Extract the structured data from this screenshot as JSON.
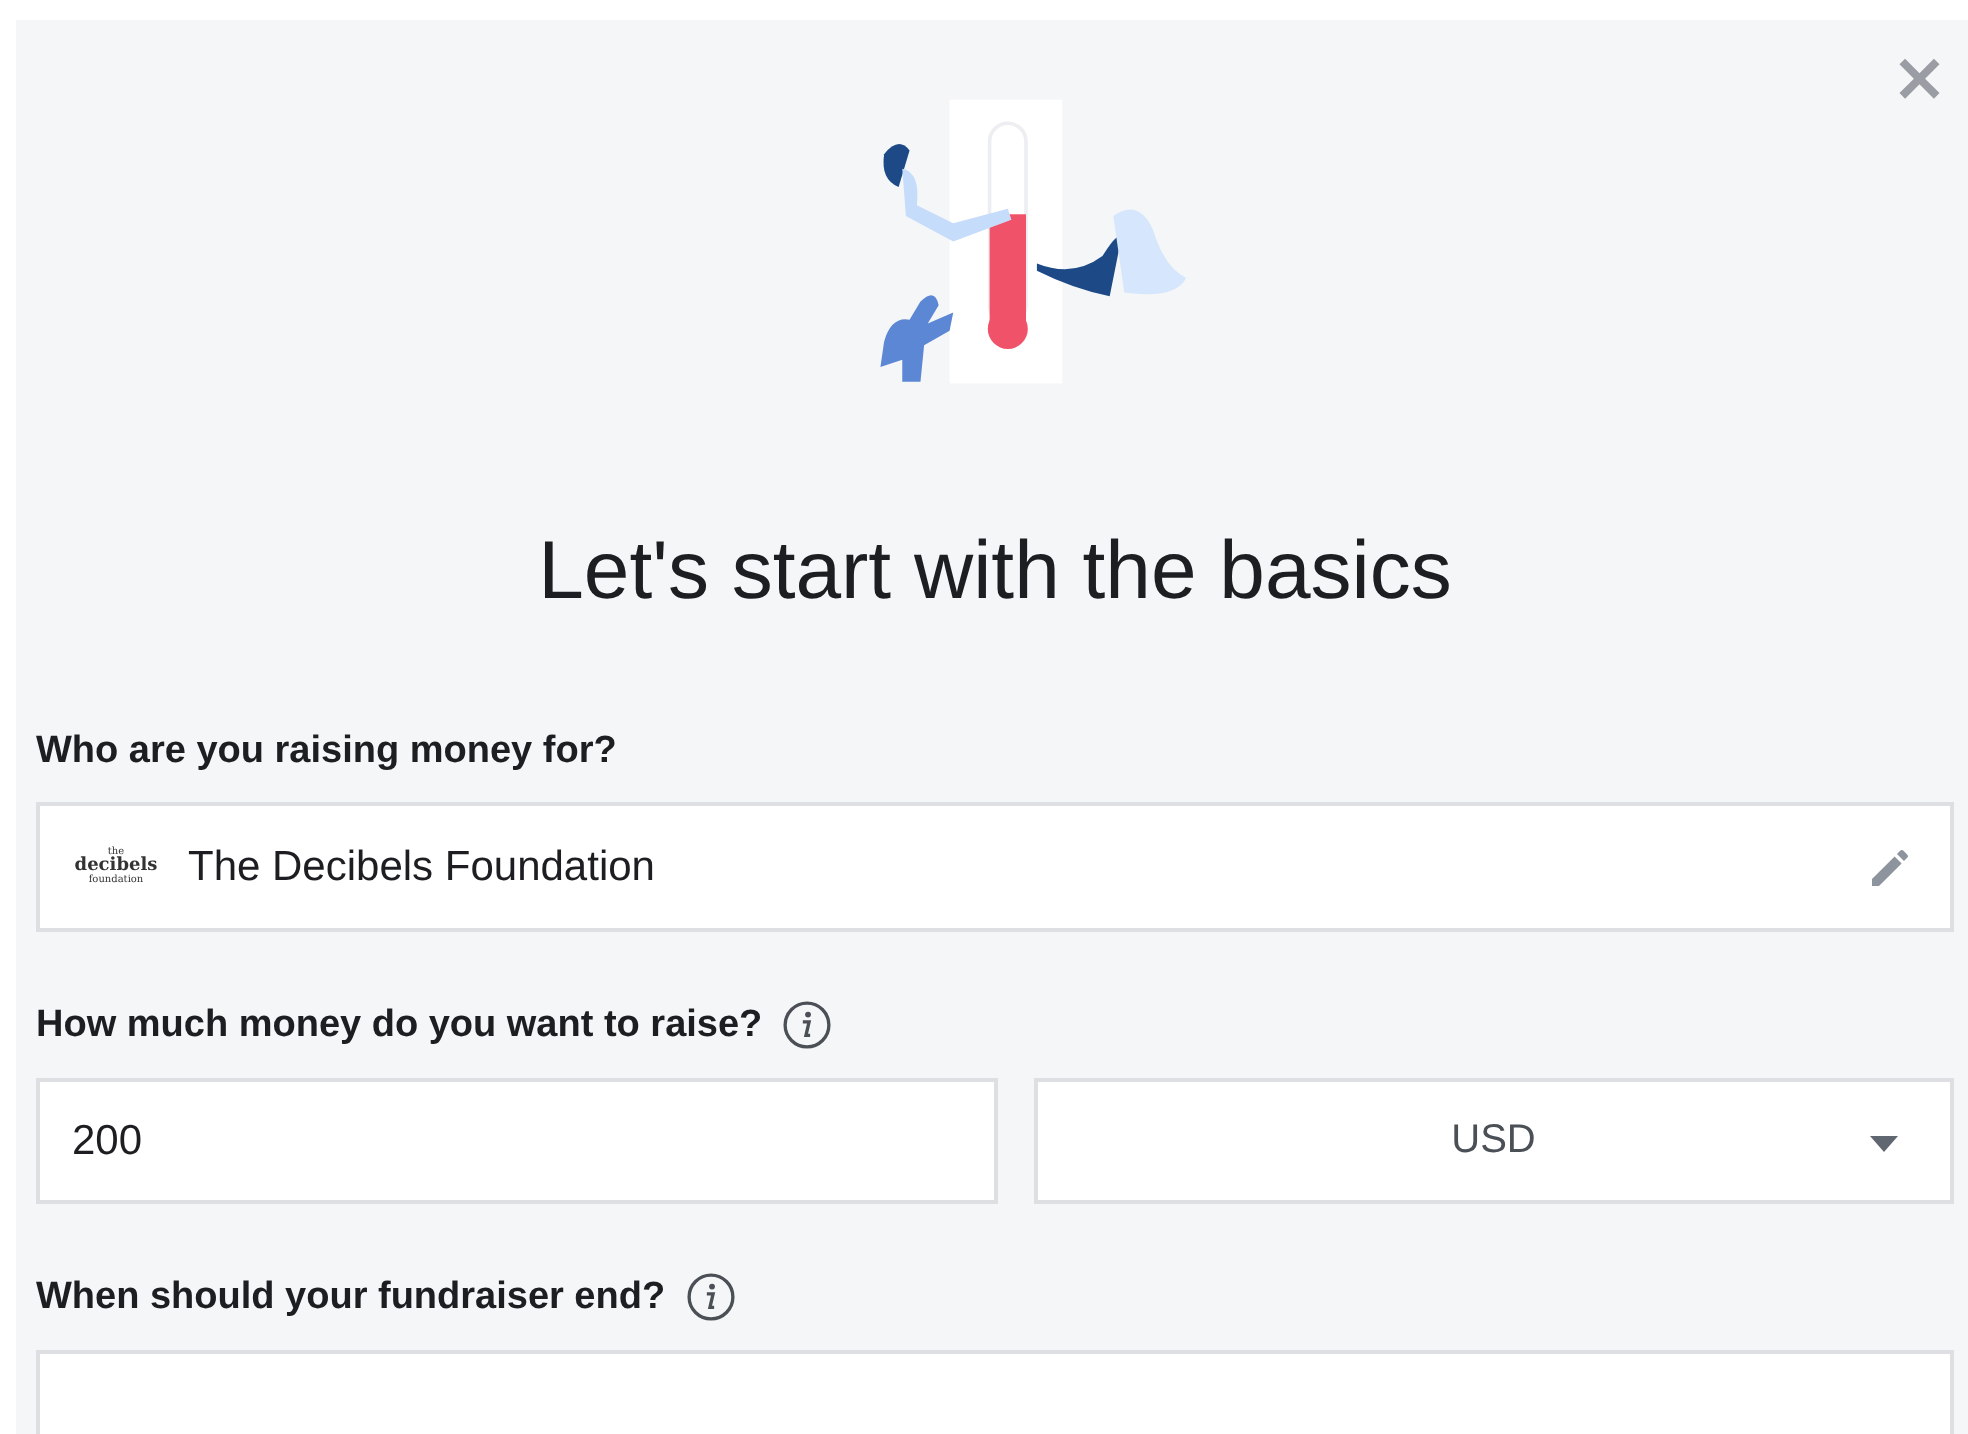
{
  "dialog": {
    "close_label": "×",
    "heading": "Let's start with the basics"
  },
  "fields": [
    {
      "kind": "organization",
      "label": "Who are you raising money for?",
      "info": false,
      "logo_lines": [
        "the",
        "decibels",
        "foundation"
      ],
      "value": "The Decibels Foundation"
    },
    {
      "kind": "amount",
      "label": "How much money do you want to raise?",
      "info": true,
      "value": "200",
      "currency": "USD"
    },
    {
      "kind": "date",
      "label": "When should your fundraiser end?",
      "info": true
    }
  ]
}
